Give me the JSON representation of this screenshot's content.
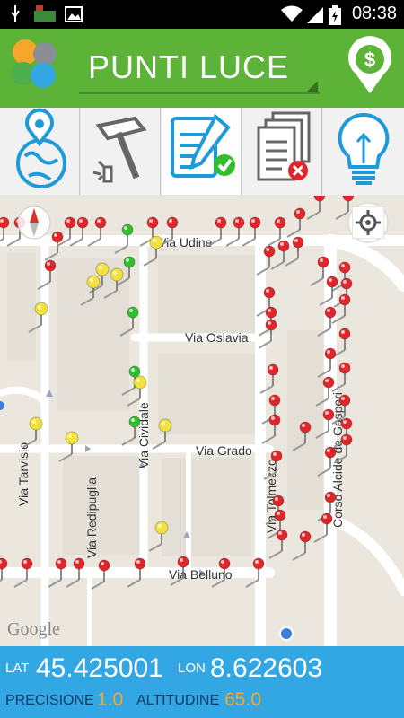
{
  "status_bar": {
    "time": "08:38"
  },
  "app": {
    "title": "PUNTI LUCE"
  },
  "toolbar": {
    "tools": [
      {
        "icon": "globe-pin-icon"
      },
      {
        "icon": "hammer-icon"
      },
      {
        "icon": "document-check-icon"
      },
      {
        "icon": "documents-delete-icon"
      },
      {
        "icon": "lightbulb-icon"
      }
    ]
  },
  "map": {
    "streets": {
      "udine": "Via Udine",
      "oslavia": "Via Oslavia",
      "grado": "Via Grado",
      "belluno": "Via Belluno",
      "tarvisio": "Via Tarvisio",
      "redipuglia": "Via Redipuglia",
      "cividale": "Via Cividale",
      "tolmezzo": "Via Tolmezzo",
      "de_gasperi": "Corso Alcide de Gasperi"
    },
    "attribution": "Google"
  },
  "info": {
    "lat_label": "LAT",
    "lat_value": "45.425001",
    "lon_label": "LON",
    "lon_value": "8.622603",
    "precision_label": "PRECISIONE",
    "precision_value": "1.0",
    "altitude_label": "ALTITUDINE",
    "altitude_value": "65.0"
  },
  "colors": {
    "title_bar": "#5cb338",
    "info_bar": "#33a6e4",
    "pin_red": "#e0262b",
    "pin_green": "#2fbf2a",
    "pin_yellow": "#f3e23d"
  }
}
